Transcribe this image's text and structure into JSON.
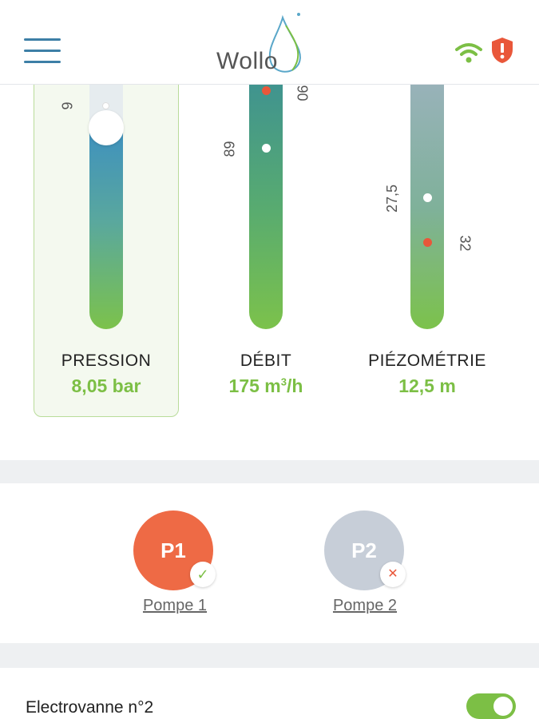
{
  "header": {
    "logo_text": "Wollo",
    "icons": [
      "menu-icon",
      "wifi-icon",
      "alert-shield-icon"
    ],
    "colors": {
      "brand_blue": "#3d7fa6",
      "wifi_green": "#7cbf45",
      "alert_red": "#e9573a"
    }
  },
  "gauges": [
    {
      "title": "PRESSION",
      "value": "8,05 bar",
      "marks": [
        "9"
      ]
    },
    {
      "title": "DÉBIT",
      "value_number": "175 m",
      "value_unit_sup": "3",
      "value_suffix": "/h",
      "marks": [
        "89",
        "90"
      ]
    },
    {
      "title": "PIÉZOMÉTRIE",
      "value": "12,5 m",
      "marks": [
        "27,5",
        "32"
      ]
    }
  ],
  "pumps": [
    {
      "short": "P1",
      "label": "Pompe 1",
      "status": "ok",
      "badge": "✓",
      "color": "#ee6a45"
    },
    {
      "short": "P2",
      "label": "Pompe 2",
      "status": "off",
      "badge": "✕",
      "color": "#c7ced8"
    }
  ],
  "electrovanne": {
    "label": "Electrovanne n°2",
    "enabled": true
  }
}
